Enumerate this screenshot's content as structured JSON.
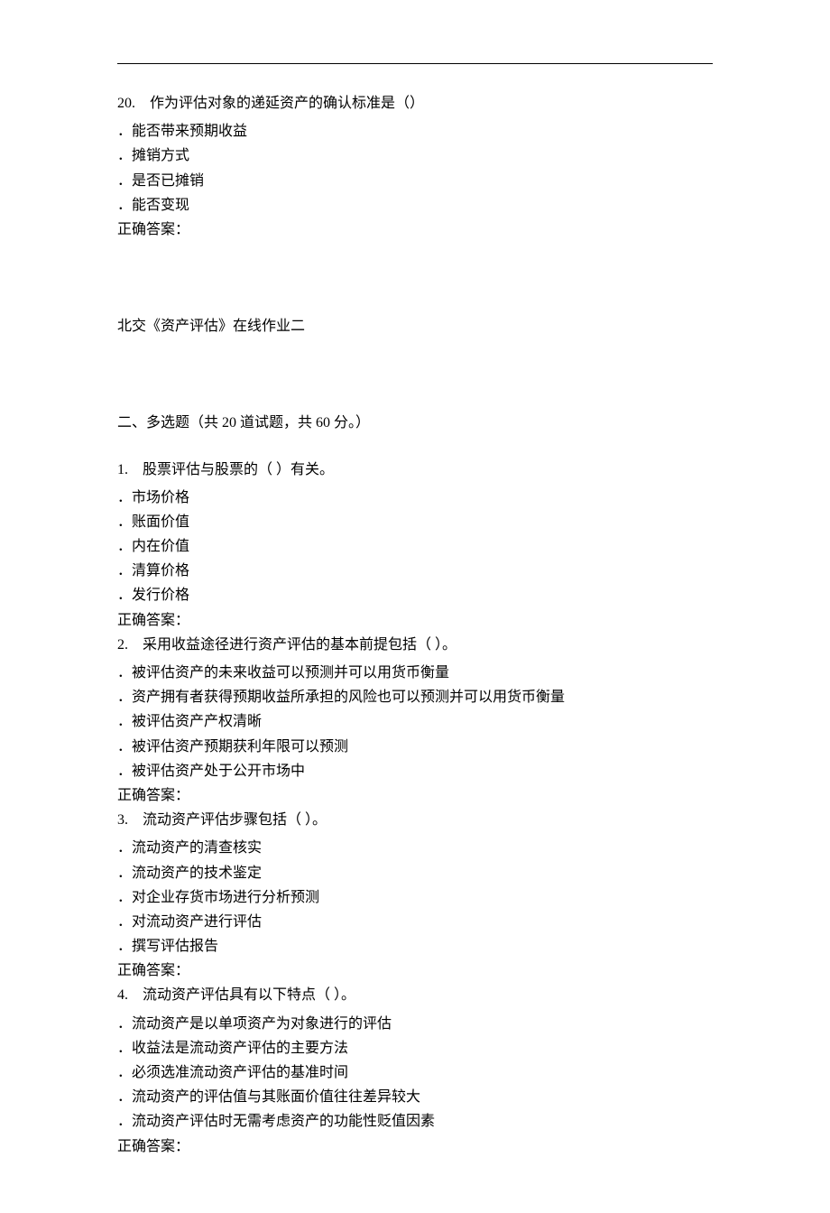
{
  "q20": {
    "stem": "20.　作为评估对象的递延资产的确认标准是（）",
    "opts": [
      "．能否带来预期收益",
      "．摊销方式",
      "．是否已摊销",
      "．能否变现"
    ],
    "ans": "正确答案："
  },
  "title2": "北交《资产评估》在线作业二",
  "section2": "二、多选题（共 20 道试题，共 60 分。）",
  "mq1": {
    "stem": "1.　股票评估与股票的（ ）有关。",
    "opts": [
      "．市场价格",
      "．账面价值",
      "．内在价值",
      "．清算价格",
      "．发行价格"
    ],
    "ans": "正确答案："
  },
  "mq2": {
    "stem": "2.　采用收益途径进行资产评估的基本前提包括（ ）。",
    "opts": [
      "．被评估资产的未来收益可以预测并可以用货币衡量",
      "．资产拥有者获得预期收益所承担的风险也可以预测并可以用货币衡量",
      "．被评估资产产权清晰",
      "．被评估资产预期获利年限可以预测",
      "．被评估资产处于公开市场中"
    ],
    "ans": "正确答案："
  },
  "mq3": {
    "stem": "3.　流动资产评估步骤包括（ ）。",
    "opts": [
      "．流动资产的清查核实",
      "．流动资产的技术鉴定",
      "．对企业存货市场进行分析预测",
      "．对流动资产进行评估",
      "．撰写评估报告"
    ],
    "ans": "正确答案："
  },
  "mq4": {
    "stem": "4.　流动资产评估具有以下特点（ ）。",
    "opts": [
      "．流动资产是以单项资产为对象进行的评估",
      "．收益法是流动资产评估的主要方法",
      "．必须选准流动资产评估的基准时间",
      "．流动资产的评估值与其账面价值往往差异较大",
      "．流动资产评估时无需考虑资产的功能性贬值因素"
    ],
    "ans": "正确答案："
  }
}
